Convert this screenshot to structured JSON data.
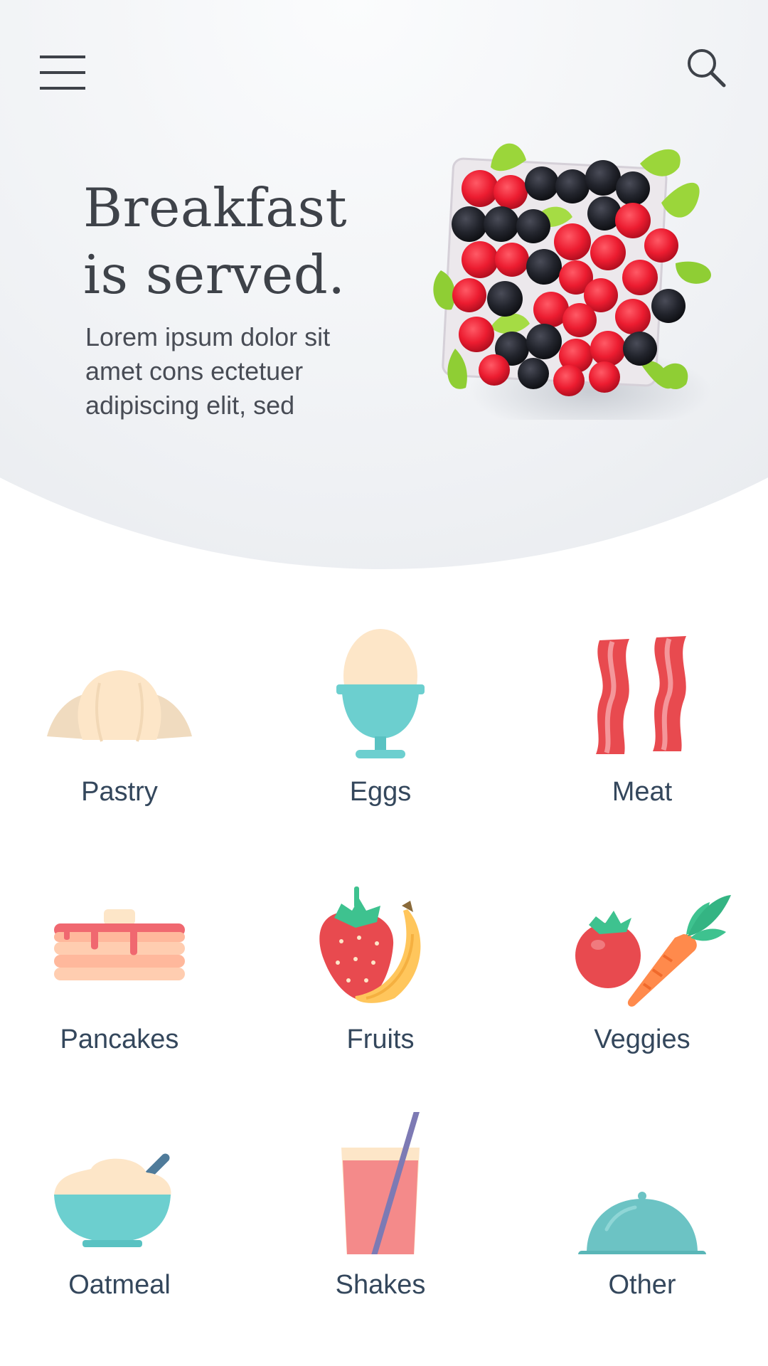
{
  "header": {
    "menu_icon": "hamburger-menu-icon",
    "search_icon": "search-icon"
  },
  "hero": {
    "title_line1": "Breakfast",
    "title_line2": "is served.",
    "description": "Lorem ipsum dolor sit amet cons ectetuer adipiscing elit, sed",
    "image": "berries-basket-image"
  },
  "categories": [
    {
      "label": "Pastry",
      "icon": "croissant-icon"
    },
    {
      "label": "Eggs",
      "icon": "egg-cup-icon"
    },
    {
      "label": "Meat",
      "icon": "bacon-icon"
    },
    {
      "label": "Pancakes",
      "icon": "pancakes-icon"
    },
    {
      "label": "Fruits",
      "icon": "strawberry-banana-icon"
    },
    {
      "label": "Veggies",
      "icon": "tomato-carrot-icon"
    },
    {
      "label": "Oatmeal",
      "icon": "oatmeal-bowl-icon"
    },
    {
      "label": "Shakes",
      "icon": "shake-glass-icon"
    },
    {
      "label": "Other",
      "icon": "cloche-icon"
    }
  ],
  "colors": {
    "title": "#3e4249",
    "label": "#34475c",
    "teal": "#6ccfcf",
    "red": "#e84a4f",
    "cream": "#fde6c8"
  }
}
